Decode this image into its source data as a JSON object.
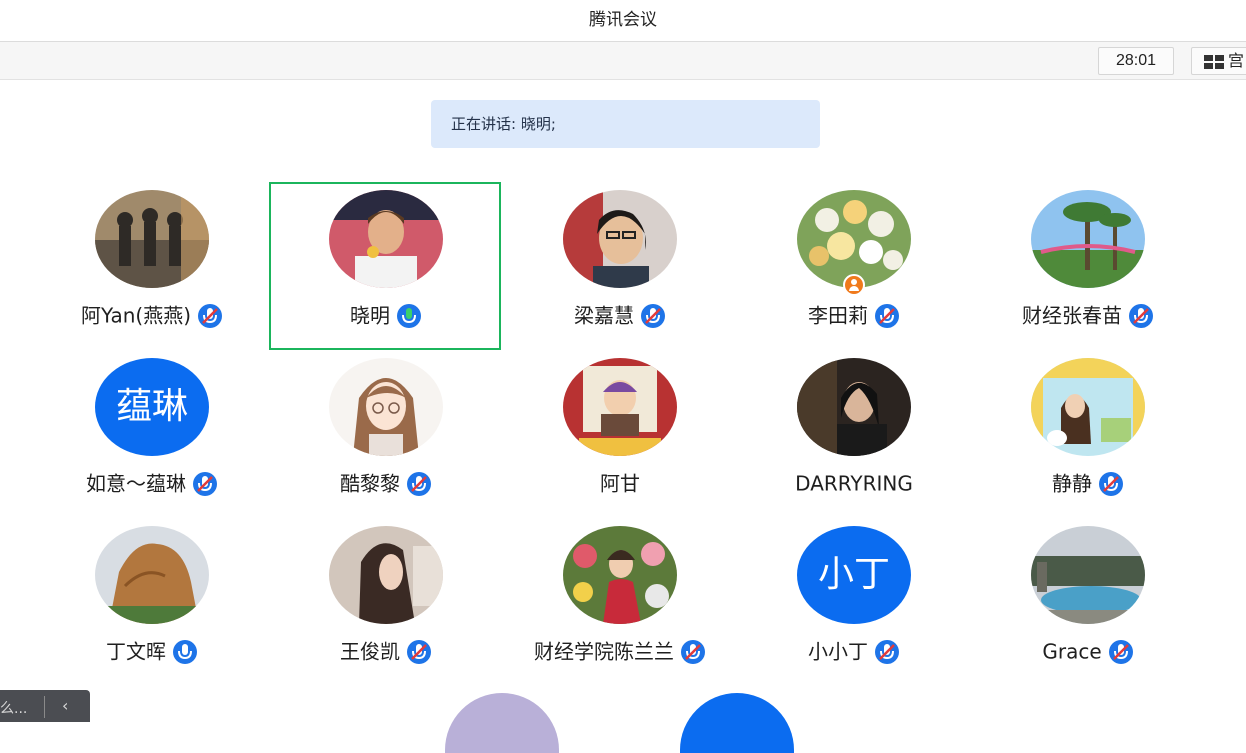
{
  "window": {
    "title": "腾讯会议"
  },
  "toolbar": {
    "timer": "28:01",
    "view_label": "宫"
  },
  "speaking": {
    "text": "正在讲话: 晓明;"
  },
  "participants": [
    {
      "name": "阿Yan(燕燕)",
      "mic": "muted"
    },
    {
      "name": "晓明",
      "mic": "speaking",
      "highlighted": true
    },
    {
      "name": "梁嘉慧",
      "mic": "muted"
    },
    {
      "name": "李田莉",
      "mic": "muted",
      "host_badge": true
    },
    {
      "name": "财经张春苗",
      "mic": "muted"
    },
    {
      "name": "如意～蕴琳",
      "mic": "muted",
      "avatar_text": "蕴琳"
    },
    {
      "name": "酷黎黎",
      "mic": "muted"
    },
    {
      "name": "阿甘",
      "mic": "none"
    },
    {
      "name": "DARRYRING",
      "mic": "none"
    },
    {
      "name": "静静",
      "mic": "muted"
    },
    {
      "name": "丁文晖",
      "mic": "on"
    },
    {
      "name": "王俊凯",
      "mic": "muted"
    },
    {
      "name": "财经学院陈兰兰",
      "mic": "muted"
    },
    {
      "name": "小小丁",
      "mic": "muted",
      "avatar_text": "小丁"
    },
    {
      "name": "Grace",
      "mic": "muted"
    }
  ],
  "bottom_bar": {
    "text": "么...",
    "collapse_icon": "chevron-left-icon"
  },
  "colors": {
    "accent_blue": "#0b6cf0",
    "speaking_green": "#1bb55c",
    "highlight_bg": "#dce9fb"
  }
}
